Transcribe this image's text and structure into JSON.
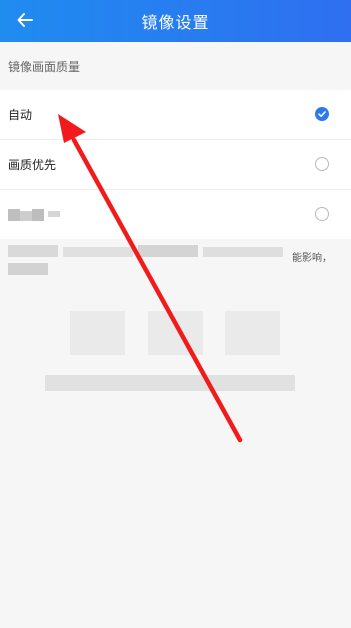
{
  "header": {
    "title": "镜像设置",
    "back_icon": "arrow-left-icon"
  },
  "section": {
    "label": "镜像画面质量"
  },
  "options": [
    {
      "label": "自动",
      "selected": true
    },
    {
      "label": "画质优先",
      "selected": false
    },
    {
      "label": "",
      "selected": false,
      "redacted": true
    }
  ],
  "note": {
    "visible_fragment": "能影响，"
  },
  "colors": {
    "header_start": "#1f8cf0",
    "header_end": "#2f6ff0",
    "accent": "#2e78f0",
    "annotation_arrow": "#f21b1b"
  }
}
